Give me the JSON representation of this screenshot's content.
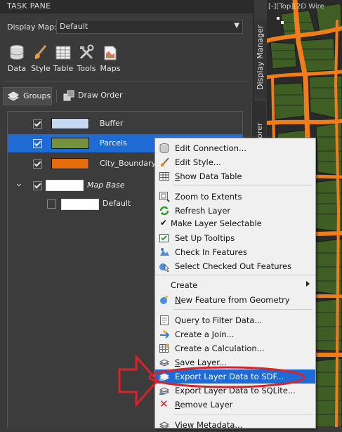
{
  "panel": {
    "title": "TASK PANE"
  },
  "display_map": {
    "label": "Display Map:",
    "value": "Default"
  },
  "toolbar": {
    "items": [
      {
        "label": "Data",
        "icon": "database-icon"
      },
      {
        "label": "Style",
        "icon": "brush-icon"
      },
      {
        "label": "Table",
        "icon": "table-icon"
      },
      {
        "label": "Tools",
        "icon": "tools-icon"
      },
      {
        "label": "Maps",
        "icon": "maps-icon"
      }
    ]
  },
  "view_tabs": {
    "groups": "Groups",
    "draw_order": "Draw Order"
  },
  "side_tabs": {
    "display_manager": "Display Manager",
    "explorer": "lorer"
  },
  "map_corner_text": "[-][Top][2D Wire",
  "layers": [
    {
      "name": "Buffer",
      "checked": true,
      "color": "#c5d9f1",
      "selected": false
    },
    {
      "name": "Parcels",
      "checked": true,
      "color": "#76923c",
      "selected": true
    },
    {
      "name": "City_Boundary",
      "checked": true,
      "color": "#e46c0a",
      "selected": false
    }
  ],
  "map_base": {
    "name": "Map Base",
    "checked": true,
    "child": "Default",
    "child_checked": false
  },
  "context_menu": {
    "items": [
      {
        "label": "Edit Connection...",
        "icon": "database-icon"
      },
      {
        "label": "Edit Style...",
        "icon": "brush-icon"
      },
      {
        "label": "Show Data Table",
        "icon": "table-icon"
      },
      {
        "label": "Zoom to Extents",
        "icon": "zoom-extents-icon"
      },
      {
        "label": "Refresh Layer",
        "icon": "refresh-icon"
      },
      {
        "label": "Make Layer Selectable",
        "icon": "checkmark-icon"
      },
      {
        "label": "Set Up Tooltips",
        "icon": "tooltip-icon"
      },
      {
        "label": "Check In Features",
        "icon": "check-in-icon"
      },
      {
        "label": "Select Checked Out Features",
        "icon": "select-checked-out-icon"
      },
      {
        "label": "Create",
        "icon": ""
      },
      {
        "label": "New Feature from Geometry",
        "icon": "new-feature-icon"
      },
      {
        "label": "Query to Filter Data...",
        "icon": "query-icon"
      },
      {
        "label": "Create a Join...",
        "icon": "join-icon"
      },
      {
        "label": "Create a Calculation...",
        "icon": "calculation-icon"
      },
      {
        "label": "Save Layer...",
        "icon": "save-layer-icon"
      },
      {
        "label": "Export Layer Data to SDF...",
        "icon": "export-sdf-icon"
      },
      {
        "label": "Export Layer Data to SQLite...",
        "icon": "export-sqlite-icon"
      },
      {
        "label": "Remove Layer",
        "icon": "remove-icon"
      },
      {
        "label": "View Metadata...",
        "icon": "metadata-icon"
      }
    ]
  },
  "colors": {
    "highlight": "#1e6bd6",
    "annotation_red": "#d9232a",
    "map_orange": "#f07d1a",
    "map_green": "#3f5e24"
  }
}
